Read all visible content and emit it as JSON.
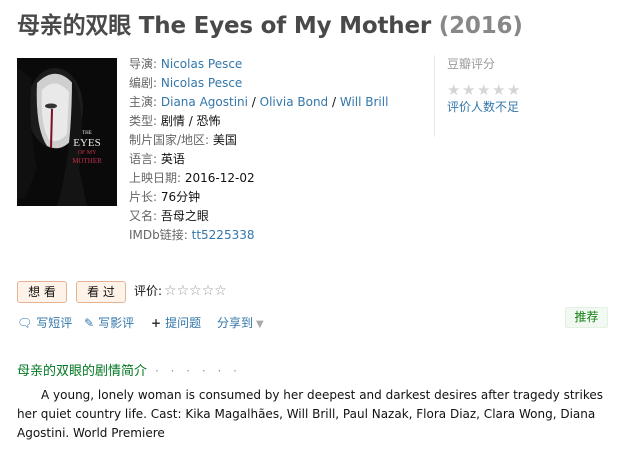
{
  "title": {
    "main": "母亲的双眼 The Eyes of My Mother",
    "year": "(2016)"
  },
  "poster": {
    "text_line1": "THE",
    "text_line2": "EYES",
    "text_line3": "OF MY",
    "text_line4": "MOTHER"
  },
  "info": {
    "director_label": "导演:",
    "director": "Nicolas Pesce",
    "writer_label": "编剧:",
    "writer": "Nicolas Pesce",
    "cast_label": "主演:",
    "cast": [
      "Diana Agostini",
      "Olivia Bond",
      "Will Brill"
    ],
    "sep": " / ",
    "genre_label": "类型:",
    "genre": "剧情 / 恐怖",
    "country_label": "制片国家/地区:",
    "country": "美国",
    "language_label": "语言:",
    "language": "英语",
    "release_label": "上映日期:",
    "release": "2016-12-02",
    "runtime_label": "片长:",
    "runtime": "76分钟",
    "aka_label": "又名:",
    "aka": "吾母之眼",
    "imdb_label": "IMDb链接:",
    "imdb": "tt5225338"
  },
  "rating": {
    "label": "豆瓣评分",
    "none_text": "评价人数不足"
  },
  "buttons": {
    "want": "想 看",
    "seen": "看 过"
  },
  "evaluate": {
    "label": "评价:"
  },
  "actions": {
    "short_review": "写短评",
    "review": "写影评",
    "ask": "提问题",
    "share": "分享到"
  },
  "recommend": "推荐",
  "synopsis": {
    "heading": "母亲的双眼的剧情简介",
    "heading_dots": "· · · · · ·",
    "text": "A young, lonely woman is consumed by her deepest and darkest desires after tragedy strikes her quiet country life. Cast: Kika Magalhães, Will Brill, Paul Nazak, Flora Diaz, Clara Wong, Diana Agostini. World Premiere"
  },
  "colors": {
    "link": "#3377aa",
    "green": "#007722",
    "button_bg": "#fff3e9"
  }
}
